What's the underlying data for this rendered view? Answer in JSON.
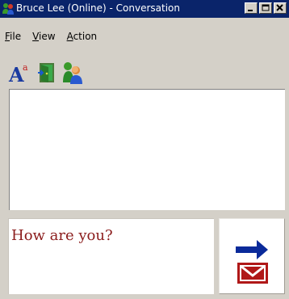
{
  "window": {
    "title": "Bruce Lee (Online) - Conversation"
  },
  "menu": {
    "items": [
      {
        "mnemonic": "F",
        "rest": "ile"
      },
      {
        "mnemonic": "V",
        "rest": "iew"
      },
      {
        "mnemonic": "A",
        "rest": "ction"
      }
    ]
  },
  "toolbar": {
    "icons": [
      "font-icon",
      "exit-door-icon",
      "add-contact-icon"
    ]
  },
  "input": {
    "text": "How are you?"
  },
  "colors": {
    "titlebar": "#0a246a",
    "window_face": "#d4d0c8",
    "input_text": "#8b1c1c",
    "send_arrow": "#0a2a9a",
    "send_envelope": "#b01818"
  }
}
